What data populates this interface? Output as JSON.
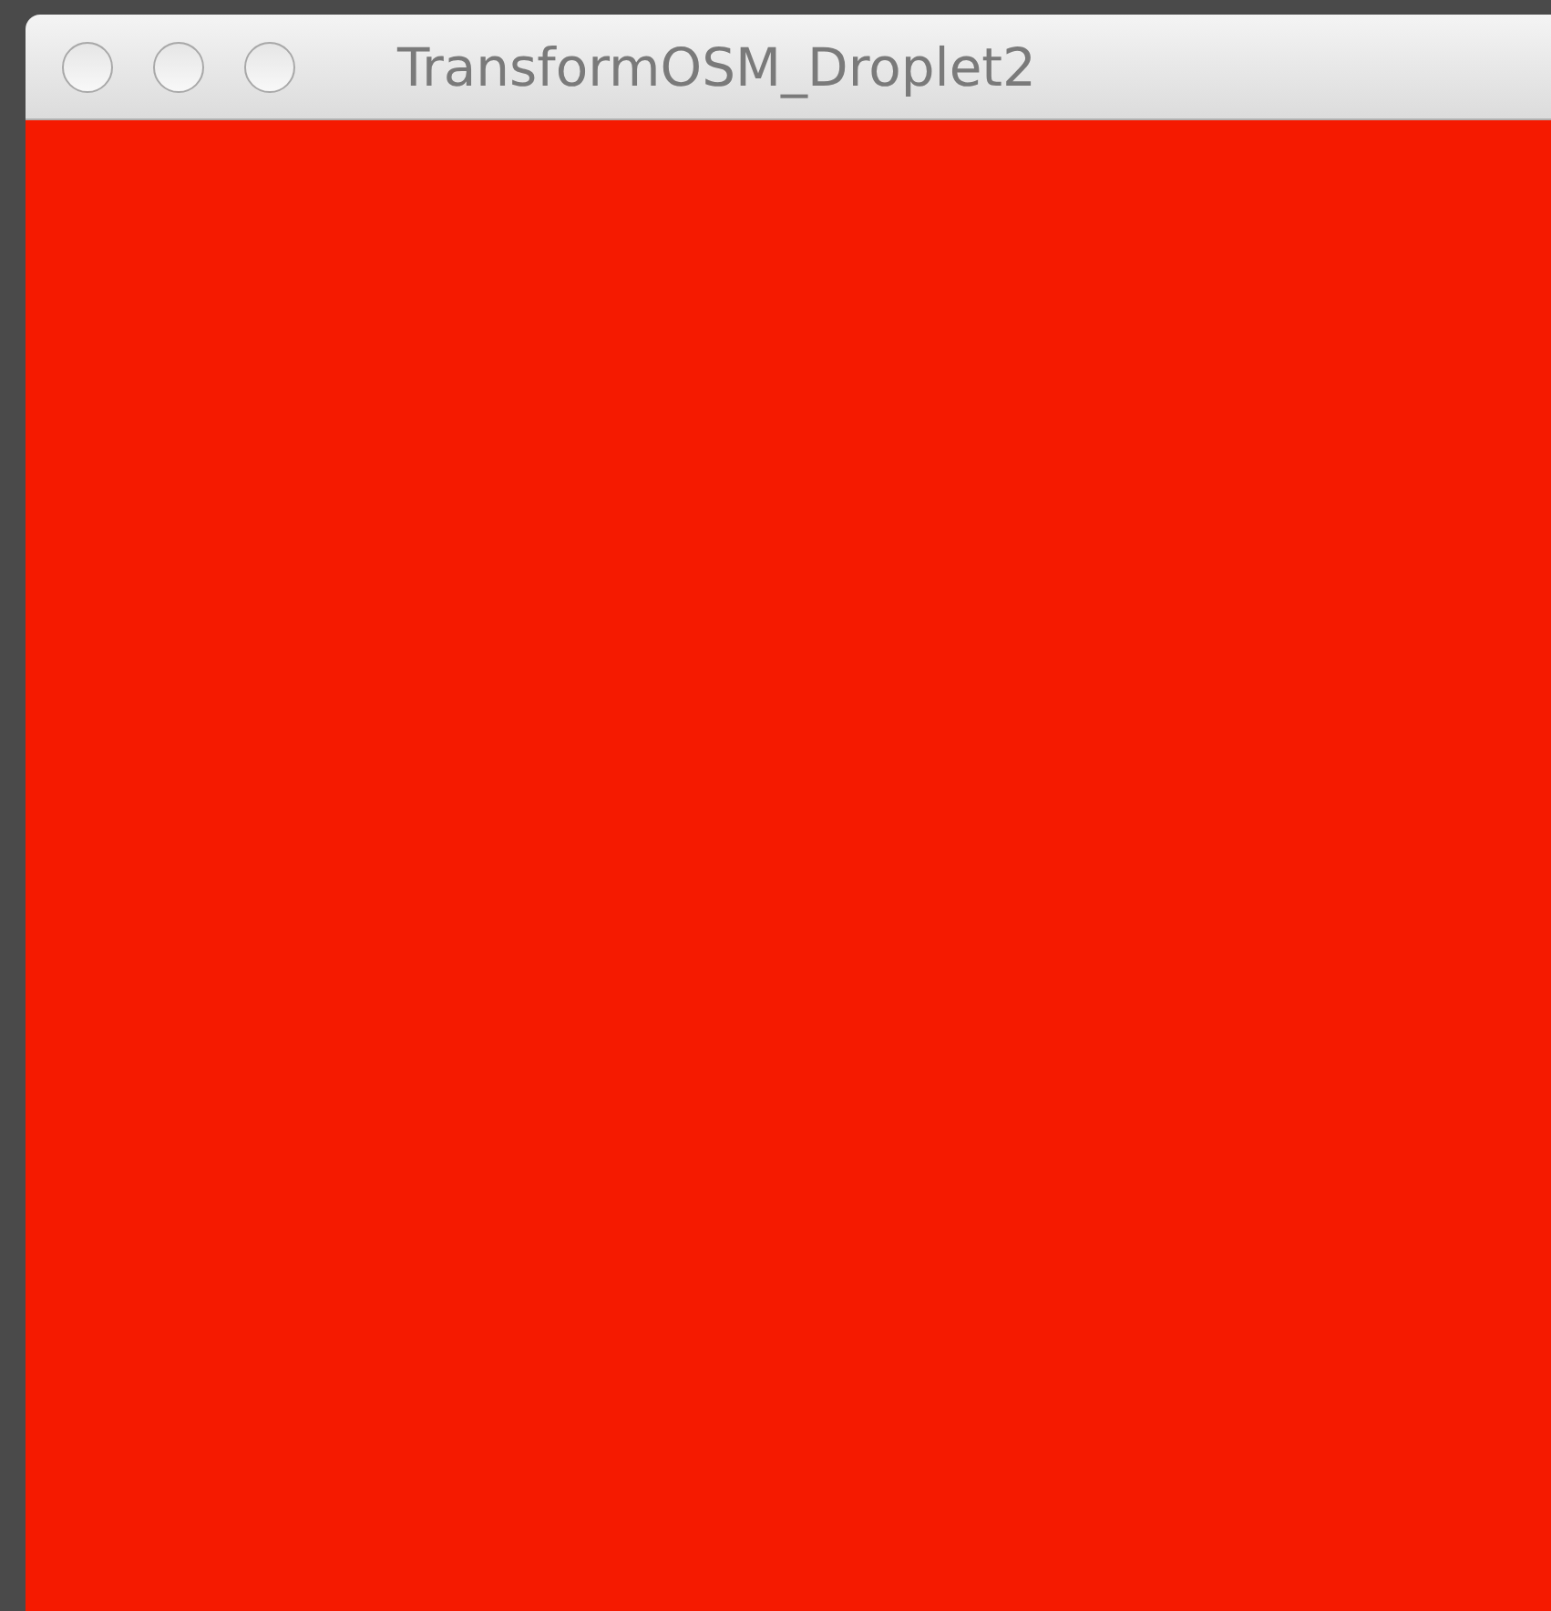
{
  "window": {
    "title": "TransformOSM_Droplet2",
    "focused": false
  }
}
